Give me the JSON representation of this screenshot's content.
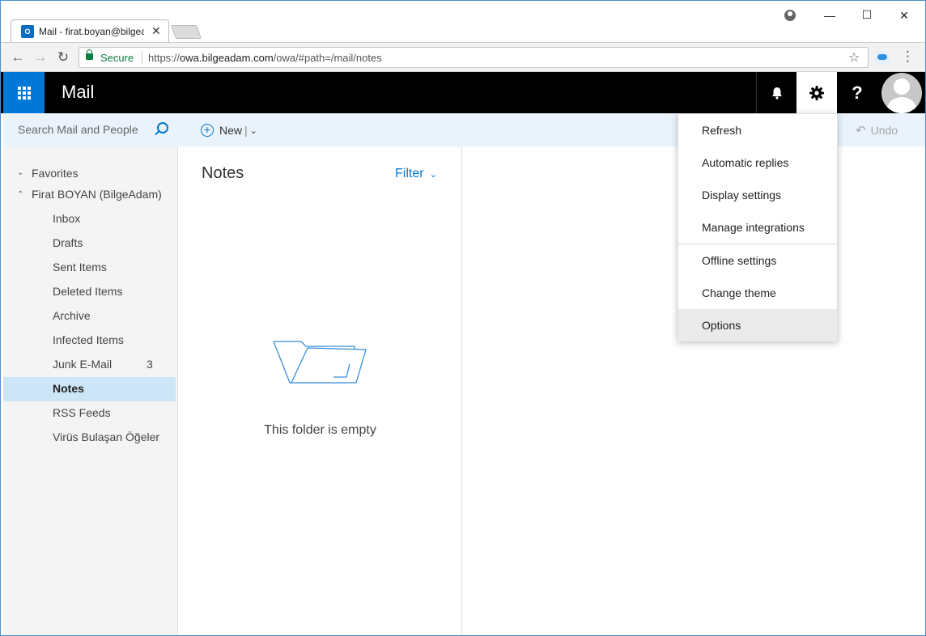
{
  "browser": {
    "tab_title": "Mail - firat.boyan@bilgeadam.com",
    "tab_favicon": "O",
    "close_glyph": "✕",
    "secure_label": "Secure",
    "url_scheme": "https://",
    "url_host": "owa.bilgeadam.com",
    "url_path": "/owa/#path=/mail/notes"
  },
  "header": {
    "app_title": "Mail",
    "help_label": "?"
  },
  "search": {
    "placeholder": "Search Mail and People"
  },
  "commands": {
    "new_label": "New",
    "undo_label": "Undo"
  },
  "nav": {
    "favorites_label": "Favorites",
    "account_label": "Firat BOYAN (BilgeAdam)",
    "folders": [
      {
        "name": "Inbox",
        "count": ""
      },
      {
        "name": "Drafts",
        "count": ""
      },
      {
        "name": "Sent Items",
        "count": ""
      },
      {
        "name": "Deleted Items",
        "count": ""
      },
      {
        "name": "Archive",
        "count": ""
      },
      {
        "name": "Infected Items",
        "count": ""
      },
      {
        "name": "Junk E-Mail",
        "count": "3"
      },
      {
        "name": "Notes",
        "count": ""
      },
      {
        "name": "RSS Feeds",
        "count": ""
      },
      {
        "name": "Virüs Bulaşan Öğeler",
        "count": ""
      }
    ],
    "selected_folder": "Notes"
  },
  "list": {
    "title": "Notes",
    "filter_label": "Filter",
    "empty_text": "This folder is empty"
  },
  "settings_menu": {
    "items": [
      "Refresh",
      "Automatic replies",
      "Display settings",
      "Manage integrations",
      "Offline settings",
      "Change theme",
      "Options"
    ],
    "highlighted": "Options"
  },
  "colors": {
    "accent": "#0078d7",
    "header_bg": "#000000",
    "selected_folder_bg": "#cde6f7",
    "command_bar_bg": "#eaf3fb",
    "secure_green": "#0b8043"
  },
  "icons": {
    "waffle": "app-launcher-icon",
    "bell": "bell-icon",
    "gear": "gear-icon",
    "help": "help-icon",
    "search": "search-icon",
    "star": "star-icon",
    "lock": "lock-icon",
    "folder": "empty-folder-icon"
  }
}
